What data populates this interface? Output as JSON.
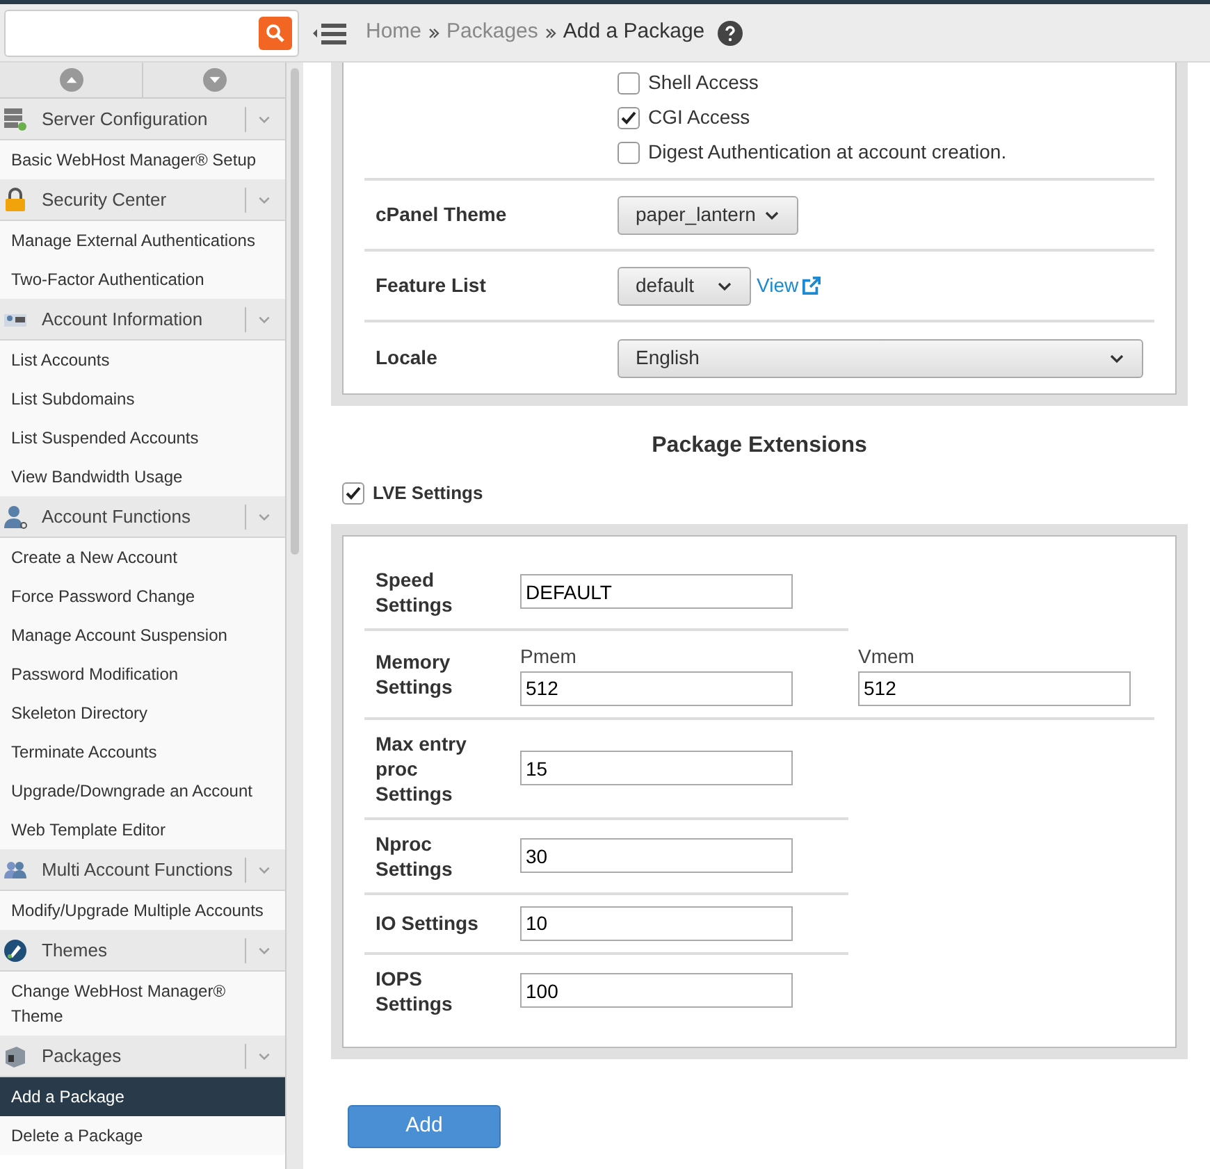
{
  "breadcrumbs": [
    {
      "label": "Home",
      "link": true
    },
    {
      "label": "Packages",
      "link": true
    },
    {
      "label": "Add a Package",
      "link": false
    }
  ],
  "sidebar": {
    "sections": [
      {
        "title": "Server Configuration",
        "items": [
          {
            "label": "Basic WebHost Manager® Setup",
            "selected": false
          }
        ]
      },
      {
        "title": "Security Center",
        "items": [
          {
            "label": "Manage External Authentications",
            "selected": false
          },
          {
            "label": "Two-Factor Authentication",
            "selected": false
          }
        ]
      },
      {
        "title": "Account Information",
        "items": [
          {
            "label": "List Accounts",
            "selected": false
          },
          {
            "label": "List Subdomains",
            "selected": false
          },
          {
            "label": "List Suspended Accounts",
            "selected": false
          },
          {
            "label": "View Bandwidth Usage",
            "selected": false
          }
        ]
      },
      {
        "title": "Account Functions",
        "items": [
          {
            "label": "Create a New Account",
            "selected": false
          },
          {
            "label": "Force Password Change",
            "selected": false
          },
          {
            "label": "Manage Account Suspension",
            "selected": false
          },
          {
            "label": "Password Modification",
            "selected": false
          },
          {
            "label": "Skeleton Directory",
            "selected": false
          },
          {
            "label": "Terminate Accounts",
            "selected": false
          },
          {
            "label": "Upgrade/Downgrade an Account",
            "selected": false
          },
          {
            "label": "Web Template Editor",
            "selected": false
          }
        ]
      },
      {
        "title": "Multi Account Functions",
        "items": [
          {
            "label": "Modify/Upgrade Multiple Accounts",
            "selected": false
          }
        ]
      },
      {
        "title": "Themes",
        "items": [
          {
            "label": "Change WebHost Manager® Theme",
            "selected": false
          }
        ]
      },
      {
        "title": "Packages",
        "items": [
          {
            "label": "Add a Package",
            "selected": true
          },
          {
            "label": "Delete a Package",
            "selected": false
          }
        ]
      }
    ]
  },
  "options": [
    {
      "label": "Shell Access",
      "checked": false
    },
    {
      "label": "CGI Access",
      "checked": true
    },
    {
      "label": "Digest Authentication at account creation.",
      "checked": false
    }
  ],
  "selects": [
    {
      "label": "cPanel Theme",
      "value": "paper_lantern",
      "wide": false
    },
    {
      "label": "Feature List",
      "value": "default",
      "wide": false,
      "link": "View"
    },
    {
      "label": "Locale",
      "value": "English",
      "wide": true
    }
  ],
  "extensions_heading": "Package Extensions",
  "lve": {
    "label": "LVE Settings",
    "checked": true,
    "rows": [
      {
        "label": "Speed Settings",
        "fields": [
          {
            "value": "DEFAULT"
          }
        ]
      },
      {
        "label": "Memory Settings",
        "fields": [
          {
            "caption": "Pmem",
            "value": "512"
          },
          {
            "caption": "Vmem",
            "value": "512"
          }
        ]
      },
      {
        "label": "Max entry proc Settings",
        "fields": [
          {
            "value": "15"
          }
        ]
      },
      {
        "label": "Nproc Settings",
        "fields": [
          {
            "value": "30"
          }
        ]
      },
      {
        "label": "IO Settings",
        "fields": [
          {
            "value": "10"
          }
        ]
      },
      {
        "label": "IOPS Settings",
        "fields": [
          {
            "value": "100"
          }
        ]
      }
    ]
  },
  "submit": "Add"
}
